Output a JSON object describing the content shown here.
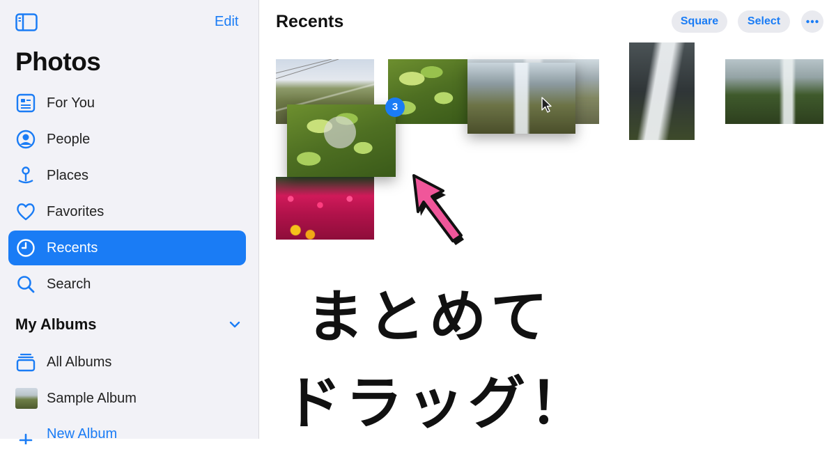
{
  "sidebar": {
    "edit_label": "Edit",
    "title": "Photos",
    "items": [
      {
        "label": "For You",
        "icon": "for-you-icon"
      },
      {
        "label": "People",
        "icon": "people-icon"
      },
      {
        "label": "Places",
        "icon": "places-icon"
      },
      {
        "label": "Favorites",
        "icon": "heart-icon"
      },
      {
        "label": "Recents",
        "icon": "clock-icon",
        "selected": true
      },
      {
        "label": "Search",
        "icon": "search-icon"
      }
    ],
    "albums_section": {
      "label": "My Albums",
      "items": [
        {
          "label": "All Albums",
          "icon": "albums-stack-icon"
        },
        {
          "label": "Sample Album",
          "icon": "album-thumbnail"
        },
        {
          "label": "New Album",
          "icon": "plus-icon"
        }
      ]
    }
  },
  "main": {
    "title": "Recents",
    "actions": {
      "square_label": "Square",
      "select_label": "Select",
      "more_icon": "ellipsis-icon"
    },
    "drag_count": "3"
  },
  "overlay": {
    "line1": "まとめて",
    "line2": "ドラッグ！"
  },
  "colors": {
    "accent": "#1a7cf5",
    "sidebar_bg": "#f2f2f7",
    "arrow_pink": "#f0569a"
  }
}
